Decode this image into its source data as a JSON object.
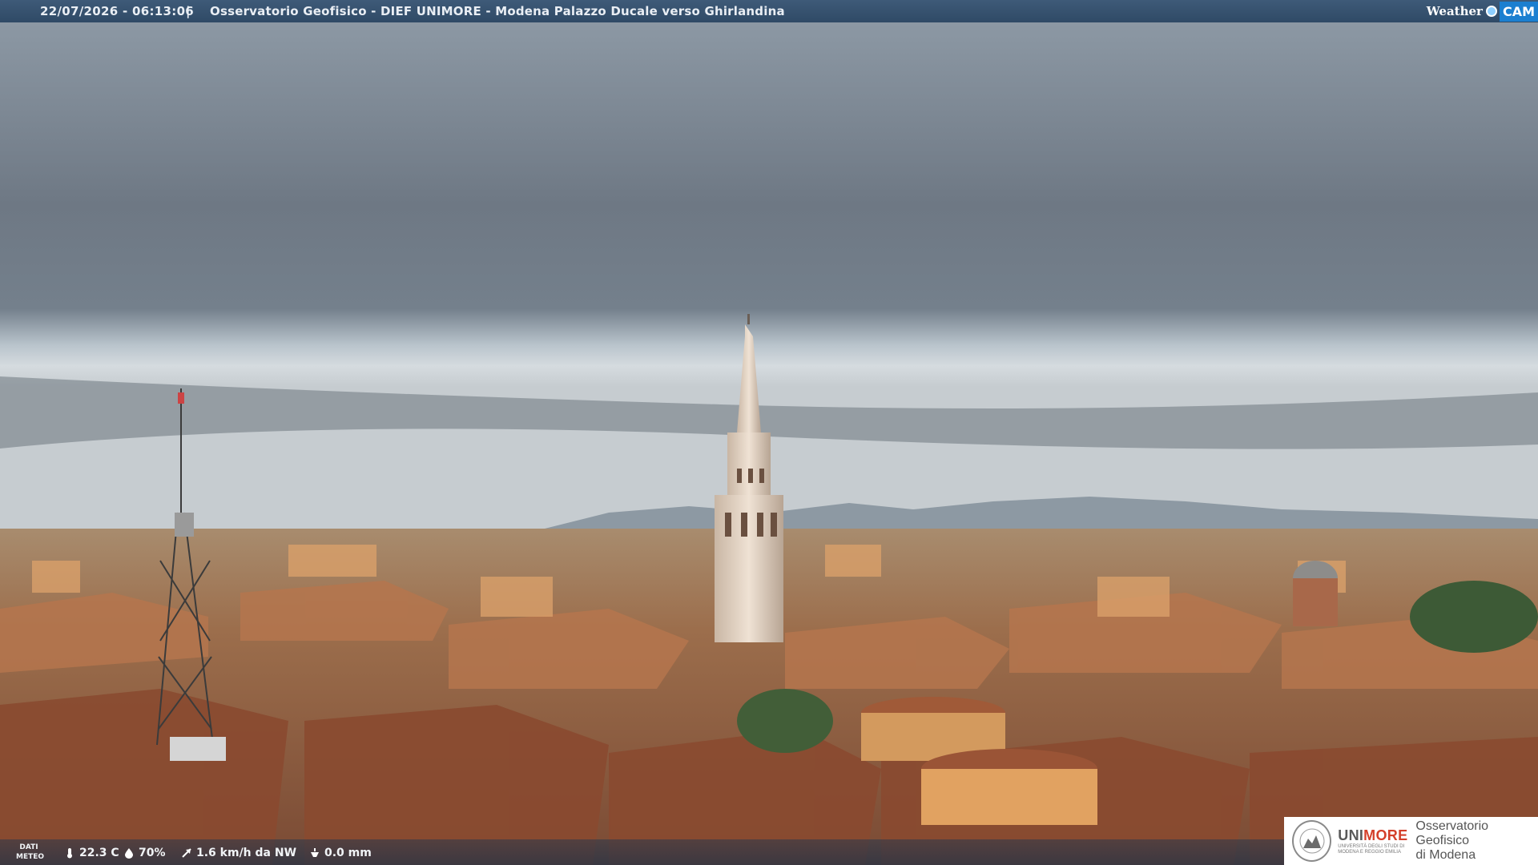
{
  "header": {
    "timestamp": "22/07/2026 - 06:13:06",
    "separator": "|",
    "title": "Osservatorio Geofisico - DIEF UNIMORE - Modena Palazzo Ducale verso Ghirlandina",
    "brand_word": "Weather",
    "brand_box": "CAM"
  },
  "meteo": {
    "label_line1": "DATI",
    "label_line2": "METEO",
    "temperature": "22.3 C",
    "humidity": "70%",
    "wind": "1.6 km/h da NW",
    "rain": "0.0 mm",
    "icons": [
      "thermometer-icon",
      "humidity-drop-icon",
      "wind-vane-icon",
      "rain-gauge-icon"
    ]
  },
  "logo": {
    "uni": "UNI",
    "more": "MORE",
    "uni_subline1": "UNIVERSITÀ DEGLI STUDI DI",
    "uni_subline2": "MODENA E REGGIO EMILIA",
    "observatory_line1": "Osservatorio Geofisico",
    "observatory_line2": "di Modena"
  },
  "colors": {
    "header_bg": "#34506d",
    "brand_blue": "#1b7fd0",
    "unimore_red": "#d4402b"
  }
}
